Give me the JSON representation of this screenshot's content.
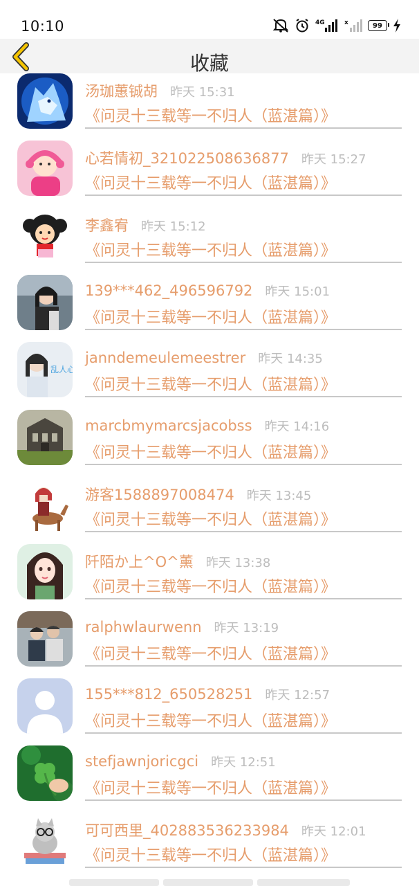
{
  "status_bar": {
    "time": "10:10",
    "battery": "99",
    "icons": [
      "mute-icon",
      "alarm-icon",
      "signal-4g-icon",
      "signal-2-icon",
      "charging-icon"
    ]
  },
  "header": {
    "title": "收藏",
    "back_icon": "chevron-left-icon",
    "accent": "#f5c400"
  },
  "colors": {
    "name": "#e69d6c",
    "time": "#bdbdbd",
    "divider": "#c8c8c8"
  },
  "favorites": [
    {
      "user": "汤珈蕙铖胡",
      "time": "昨天 15:31",
      "book": "《问灵十三载等一不归人（蓝湛篇）》",
      "avatar": "wolf"
    },
    {
      "user": "心若情初_321022508636877",
      "time": "昨天 15:27",
      "book": "《问灵十三载等一不归人（蓝湛篇）》",
      "avatar": "baby"
    },
    {
      "user": "李鑫宥",
      "time": "昨天 15:12",
      "book": "《问灵十三载等一不归人（蓝湛篇）》",
      "avatar": "cartoon-girl"
    },
    {
      "user": "139***462_496596792",
      "time": "昨天 15:01",
      "book": "《问灵十三载等一不归人（蓝湛篇）》",
      "avatar": "photo-girl"
    },
    {
      "user": "janndemeulemeestrer",
      "time": "昨天 14:35",
      "book": "《问灵十三载等一不归人（蓝湛篇）》",
      "avatar": "girl-sign"
    },
    {
      "user": "marcbmymarcsjacobss",
      "time": "昨天 14:16",
      "book": "《问灵十三载等一不归人（蓝湛篇）》",
      "avatar": "ruins"
    },
    {
      "user": "游客1588897008474",
      "time": "昨天 13:45",
      "book": "《问灵十三载等一不归人（蓝湛篇）》",
      "avatar": "deer-girl"
    },
    {
      "user": "阡陌か上^O^薰",
      "time": "昨天 13:38",
      "book": "《问灵十三载等一不归人（蓝湛篇）》",
      "avatar": "anime-girl"
    },
    {
      "user": "ralphwlaurwenn",
      "time": "昨天 13:19",
      "book": "《问灵十三载等一不归人（蓝湛篇）》",
      "avatar": "couple"
    },
    {
      "user": "155***812_650528251",
      "time": "昨天 12:57",
      "book": "《问灵十三载等一不归人（蓝湛篇）》",
      "avatar": "default"
    },
    {
      "user": "stefjawnjoricgci",
      "time": "昨天 12:51",
      "book": "《问灵十三载等一不归人（蓝湛篇）》",
      "avatar": "clover"
    },
    {
      "user": "可可西里_402883536233984",
      "time": "昨天 12:01",
      "book": "《问灵十三载等一不归人（蓝湛篇）》",
      "avatar": "cat"
    }
  ]
}
